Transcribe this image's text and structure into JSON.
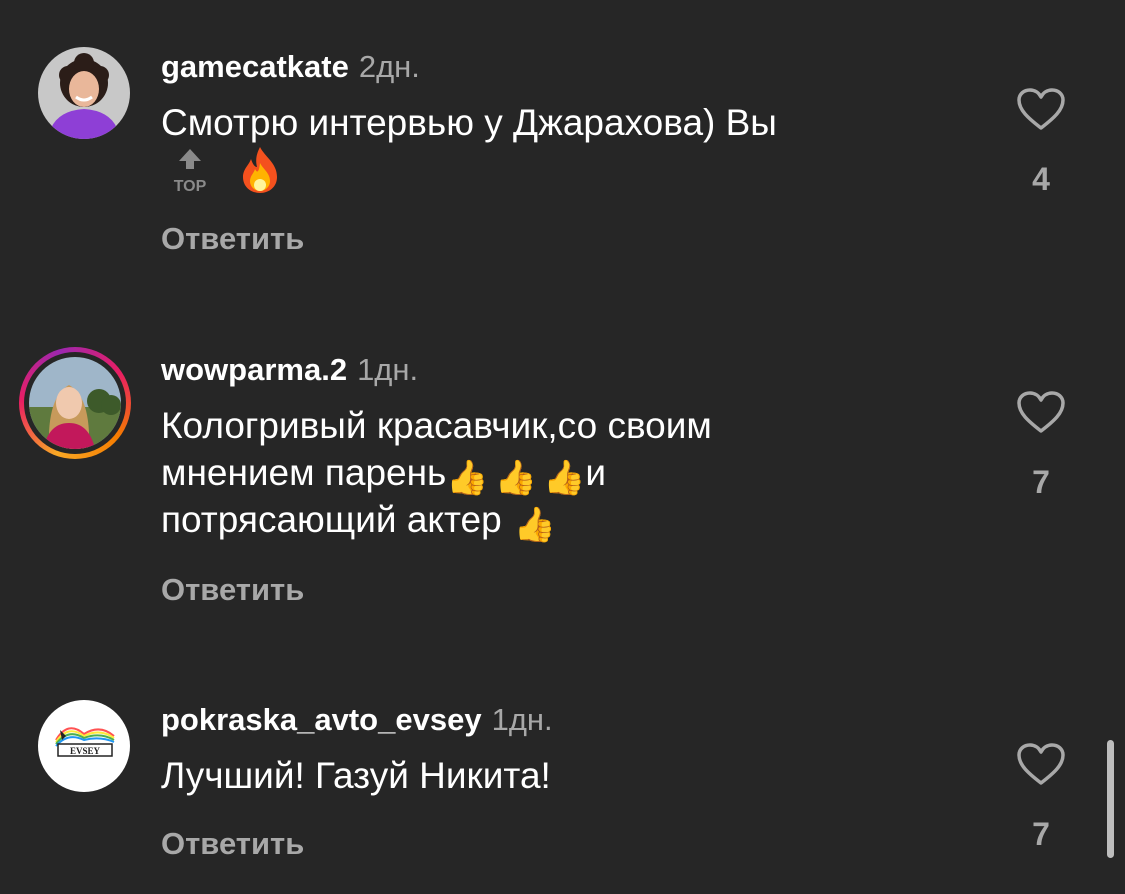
{
  "comments": [
    {
      "username": "gamecatkate",
      "timestamp": "2дн.",
      "text": "Смотрю интервью у Джарахова) Вы",
      "emojis": [
        "top-arrow-emoji",
        "fire-emoji"
      ],
      "reply_label": "Ответить",
      "likes": "4"
    },
    {
      "username": "wowparma.2",
      "timestamp": "1дн.",
      "text_line1": "Кологривый красавчик,со своим",
      "text_line2_start": "мнением парень",
      "text_line2_end": "и",
      "text_line3": "потрясающий актер",
      "emojis": [
        "thumbs-up-emoji",
        "thumbs-up-emoji",
        "thumbs-up-emoji",
        "thumbs-up-emoji"
      ],
      "reply_label": "Ответить",
      "likes": "7"
    },
    {
      "username": "pokraska_avto_evsey",
      "timestamp": "1дн.",
      "text": "Лучший! Газуй Никита!",
      "avatar_text": "EVSEY",
      "reply_label": "Ответить",
      "likes": "7"
    }
  ]
}
